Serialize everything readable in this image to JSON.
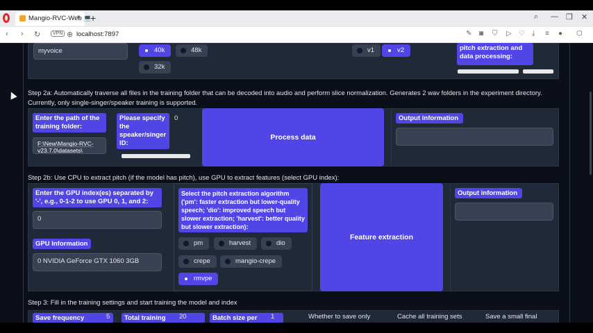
{
  "browser": {
    "tab_title": "Mangio-RVC-Web 💻",
    "tab_close": "×",
    "new_tab": "+",
    "vpn_badge": "VPN",
    "url": "localhost:7897",
    "icons": [
      "opera-logo",
      "back-icon",
      "forward-icon",
      "reload-icon",
      "shield-icon",
      "camera-icon",
      "play-icon",
      "heart-icon",
      "download-icon",
      "menu-icon",
      "profile-icon",
      "extensions-icon"
    ]
  },
  "top_row": {
    "experiment_name": "myvoice",
    "sample_rates": [
      {
        "label": "40k",
        "selected": true
      },
      {
        "label": "48k",
        "selected": false
      },
      {
        "label": "32k",
        "selected": false
      }
    ],
    "versions": [
      {
        "label": "v1",
        "selected": false
      },
      {
        "label": "v2",
        "selected": true
      }
    ],
    "cpu_label_line1": "pitch extraction and",
    "cpu_label_line2": "data processing:"
  },
  "step2a": {
    "description": "Step 2a: Automatically traverse all files in the training folder that can be decoded into audio and perform slice normalization. Generates 2 wav folders in the experiment directory. Currently, only single-singer/speaker training is supported.",
    "folder_label": "Enter the path of the training folder:",
    "folder_value_line1": "F:\\New\\Mangio-RVC-",
    "folder_value_line2": "v23.7.0\\datasets\\",
    "speaker_label": "Please specify the speaker/singer ID:",
    "speaker_value": "0",
    "process_button": "Process data",
    "output_label": "Output information",
    "output_value": ""
  },
  "step2b": {
    "description": "Step 2b: Use CPU to extract pitch (if the model has pitch), use GPU to extract features (select GPU index):",
    "gpu_index_label": "Enter the GPU index(es) separated by '-', e.g., 0-1-2 to use GPU 0, 1, and 2:",
    "gpu_index_value": "0",
    "gpu_info_label": "GPU Information",
    "gpu_info_value": "0 NVIDIA GeForce GTX 1060 3GB",
    "algo_label": "Select the pitch extraction algorithm ('pm': faster extraction but lower-quality speech; 'dio': improved speech but slower extraction; 'harvest': better quality but slower extraction):",
    "algorithms": [
      {
        "label": "pm",
        "selected": false
      },
      {
        "label": "harvest",
        "selected": false
      },
      {
        "label": "dio",
        "selected": false
      },
      {
        "label": "crepe",
        "selected": false
      },
      {
        "label": "mangio-crepe",
        "selected": false
      },
      {
        "label": "rmvpe",
        "selected": true
      }
    ],
    "feature_button": "Feature extraction",
    "output_label": "Output information",
    "output_value": ""
  },
  "step3": {
    "description": "Step 3: Fill in the training settings and start training the model and index",
    "save_frequency_label": "Save frequency",
    "save_frequency_value": "5",
    "total_training_label": "Total training",
    "total_training_value": "20",
    "batch_size_label": "Batch size per",
    "batch_size_value": "1",
    "save_only_label": "Whether to save only",
    "cache_label": "Cache all training sets",
    "save_small_label": "Save a small final"
  },
  "colors": {
    "accent": "#4f46e5",
    "background": "#0b0f19",
    "panel": "#1f2937",
    "input": "#374151"
  }
}
